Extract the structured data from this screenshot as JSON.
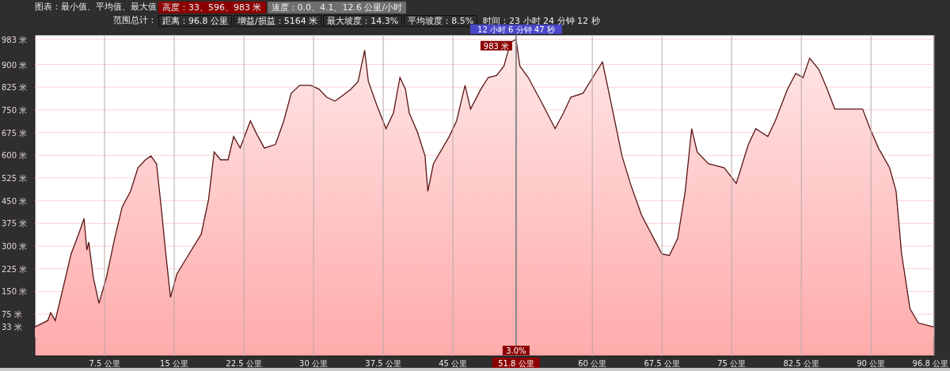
{
  "header": {
    "rows": [
      {
        "label": "图表：最小值、平均值、最大值",
        "items": [
          {
            "kind": "highlight",
            "text": "高度：33、596、983 米"
          },
          {
            "kind": "plain",
            "text": "速度：0.0、4.1、12.6 公里/小时"
          }
        ]
      },
      {
        "label": "范围总计：",
        "items": [
          {
            "kind": "outline",
            "text": "距离：96.8 公里"
          },
          {
            "kind": "outline",
            "text": "增益/损益：5164 米"
          },
          {
            "kind": "outline",
            "text": "最大坡度：14.3%"
          },
          {
            "kind": "outline",
            "text": "平均坡度：8.5%"
          },
          {
            "kind": "none",
            "text": "时间：23 小时 24 分钟 12 秒"
          }
        ]
      }
    ]
  },
  "chart": {
    "chart_data": {
      "type": "area",
      "grid": true,
      "xlim": [
        0,
        96.8
      ],
      "ylim": [
        -63,
        998
      ],
      "yticks": [
        {
          "value": 33,
          "label": "33 米"
        },
        {
          "value": 75,
          "label": "75 米"
        },
        {
          "value": 150,
          "label": "150 米"
        },
        {
          "value": 225,
          "label": "225 米"
        },
        {
          "value": 300,
          "label": "300 米"
        },
        {
          "value": 375,
          "label": "375 米"
        },
        {
          "value": 450,
          "label": "450 米"
        },
        {
          "value": 525,
          "label": "525 米"
        },
        {
          "value": 600,
          "label": "600 米"
        },
        {
          "value": 675,
          "label": "675 米"
        },
        {
          "value": 750,
          "label": "750 米"
        },
        {
          "value": 825,
          "label": "825 米"
        },
        {
          "value": 900,
          "label": "900 米"
        },
        {
          "value": 983,
          "label": "983 米"
        }
      ],
      "xticks": [
        {
          "value": 7.5,
          "label": "7.5 公里"
        },
        {
          "value": 15,
          "label": "15 公里"
        },
        {
          "value": 22.5,
          "label": "22.5 公里"
        },
        {
          "value": 30,
          "label": "30 公里"
        },
        {
          "value": 37.5,
          "label": "37.5 公里"
        },
        {
          "value": 45,
          "label": "45 公里"
        },
        {
          "value": 60,
          "label": "60 公里"
        },
        {
          "value": 67.5,
          "label": "67.5 公里"
        },
        {
          "value": 75,
          "label": "75 公里"
        },
        {
          "value": 82.5,
          "label": "82.5 公里"
        },
        {
          "value": 90,
          "label": "90 公里"
        },
        {
          "value": 96.8,
          "label": "96.8 公里"
        }
      ],
      "x": [
        0,
        1.4,
        1.7,
        2.2,
        3.1,
        3.9,
        4.7,
        5.3,
        5.6,
        5.8,
        6.3,
        6.9,
        7.7,
        8.6,
        9.4,
        10.3,
        11.1,
        11.9,
        12.5,
        13.1,
        13.6,
        14.1,
        14.6,
        15.3,
        16.6,
        17.9,
        18.7,
        19.3,
        20.0,
        20.8,
        21.4,
        22.1,
        23.2,
        23.8,
        24.7,
        25.9,
        26.8,
        27.6,
        28.5,
        29.7,
        30.6,
        31.4,
        32.3,
        32.9,
        34.0,
        34.8,
        35.5,
        35.9,
        36.8,
        37.8,
        38.6,
        39.3,
        39.9,
        40.3,
        41.2,
        42.0,
        42.3,
        42.9,
        44.6,
        45.4,
        46.3,
        46.9,
        48.0,
        48.8,
        49.7,
        50.5,
        51.2,
        51.8,
        52.2,
        53.1,
        54.7,
        56.0,
        56.9,
        57.7,
        59.0,
        60.3,
        61.1,
        61.9,
        63.2,
        64.1,
        65.3,
        66.6,
        67.5,
        68.3,
        69.2,
        70.0,
        70.7,
        71.3,
        72.5,
        74.2,
        75.5,
        76.8,
        77.6,
        78.9,
        79.7,
        81.0,
        81.9,
        82.7,
        83.4,
        84.4,
        85.3,
        86.1,
        87.8,
        89.1,
        89.9,
        90.8,
        92.0,
        92.7,
        93.3,
        94.2,
        95.1,
        96.8
      ],
      "series": [
        {
          "color": "#5a1414",
          "values": [
            33,
            54,
            80,
            54,
            170,
            274,
            339,
            391,
            287,
            313,
            196,
            111,
            196,
            326,
            429,
            481,
            559,
            585,
            598,
            572,
            429,
            274,
            131,
            209,
            274,
            339,
            455,
            611,
            585,
            585,
            662,
            624,
            714,
            675,
            624,
            636,
            714,
            805,
            831,
            831,
            818,
            792,
            779,
            792,
            818,
            844,
            947,
            844,
            766,
            688,
            740,
            857,
            818,
            740,
            675,
            598,
            481,
            572,
            662,
            714,
            831,
            753,
            818,
            857,
            864,
            895,
            973,
            983,
            895,
            857,
            766,
            688,
            740,
            792,
            805,
            870,
            908,
            792,
            598,
            507,
            403,
            326,
            274,
            269,
            326,
            481,
            688,
            611,
            572,
            559,
            507,
            636,
            688,
            662,
            714,
            818,
            870,
            857,
            921,
            883,
            818,
            753,
            753,
            753,
            688,
            624,
            559,
            481,
            274,
            93,
            46,
            33
          ]
        }
      ],
      "ref_lines": [
        {
          "axis": "x",
          "value": 51.8
        }
      ],
      "annotations": [
        {
          "x": 51.8,
          "y": 983,
          "text": "983 米"
        }
      ]
    },
    "cursor": {
      "time": "12 小时 6 分钟 47 秒",
      "grade": "3.0%",
      "distance": "51.8 公里"
    }
  }
}
